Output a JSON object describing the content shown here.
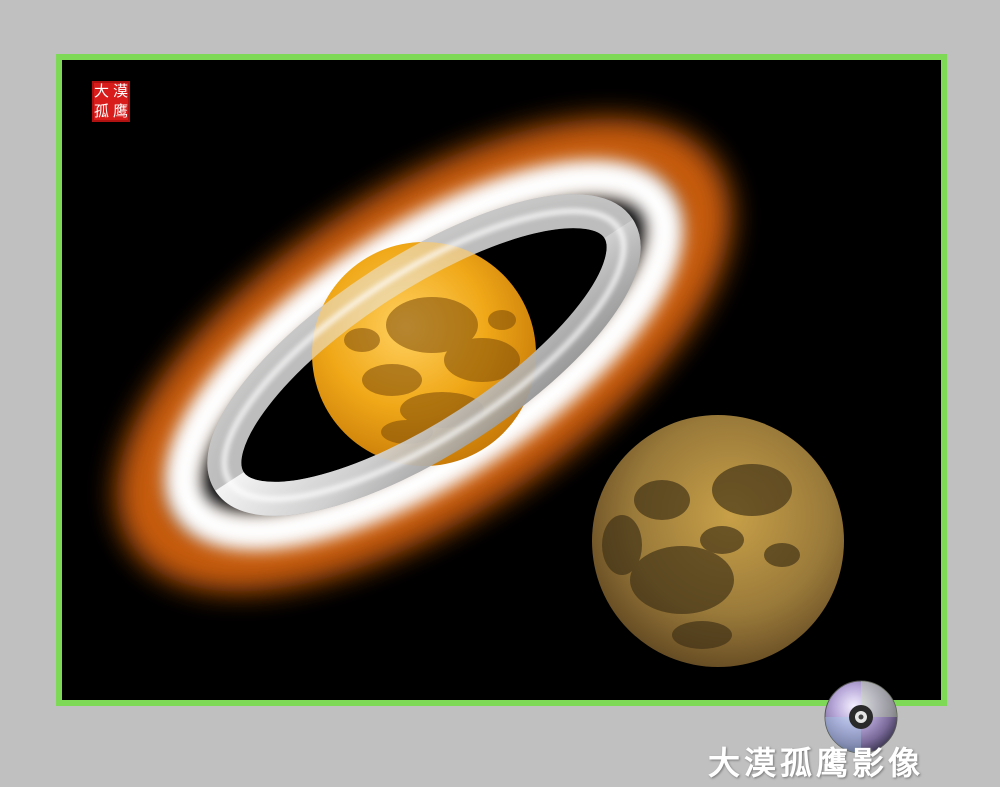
{
  "artwork": {
    "seal_chars": [
      "大",
      "漠",
      "孤",
      "鹰"
    ],
    "signature": "大漠孤鹰影像"
  },
  "colors": {
    "background": "#c0c0c0",
    "frame_border": "#7ed957",
    "sky": "#000000",
    "seal": "#d81c1c",
    "ring_glow": "#d2600a",
    "planet": "#f0a818",
    "moon": "#9a7a3a"
  },
  "icons": [
    "seal-stamp",
    "disc-logo"
  ]
}
